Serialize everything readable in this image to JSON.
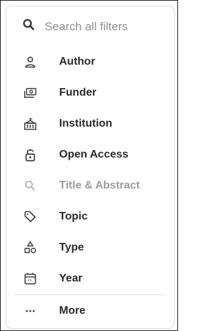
{
  "search": {
    "placeholder": "Search all filters",
    "icon": "search-icon"
  },
  "menu": {
    "items": [
      {
        "label": "Author",
        "icon": "person-icon",
        "enabled": true
      },
      {
        "label": "Funder",
        "icon": "funder-icon",
        "enabled": true
      },
      {
        "label": "Institution",
        "icon": "institution-icon",
        "enabled": true
      },
      {
        "label": "Open Access",
        "icon": "lock-open-icon",
        "enabled": true
      },
      {
        "label": "Title & Abstract",
        "icon": "search-icon",
        "enabled": false
      },
      {
        "label": "Topic",
        "icon": "tag-icon",
        "enabled": true
      },
      {
        "label": "Type",
        "icon": "shapes-icon",
        "enabled": true
      },
      {
        "label": "Year",
        "icon": "calendar-icon",
        "enabled": true
      }
    ],
    "more": {
      "label": "More",
      "icon": "more-dots-icon"
    }
  },
  "colors": {
    "text": "#2a2a2e",
    "disabled_text": "#9c9ca2",
    "placeholder": "#8e8e95",
    "border": "#d9d9de"
  }
}
